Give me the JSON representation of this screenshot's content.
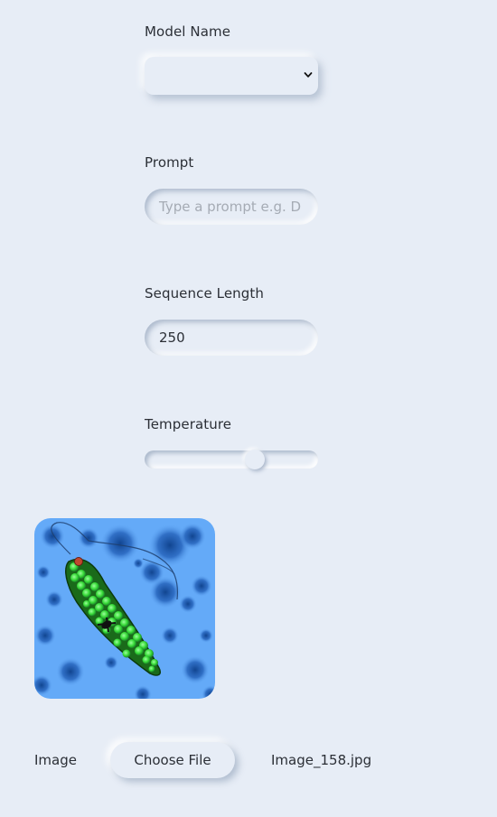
{
  "model": {
    "label": "Model Name",
    "selected": ""
  },
  "prompt": {
    "label": "Prompt",
    "placeholder": "Type a prompt e.g. Describe this image",
    "visible_placeholder": "Type a prompt e.g. D",
    "value": ""
  },
  "sequence_length": {
    "label": "Sequence Length",
    "value": "250"
  },
  "temperature": {
    "label": "Temperature",
    "level_fraction": 0.65
  },
  "image_upload": {
    "label": "Image",
    "button_label": "Choose File",
    "file_name": "Image_158.jpg"
  },
  "icons": {
    "select_arrow": "chevron-down-icon"
  },
  "colors": {
    "background": "#e7edf6",
    "text": "#2b2f36",
    "placeholder": "#a5abb4",
    "image_background": "#64aaf8",
    "cell_green": "#3ee03e"
  }
}
